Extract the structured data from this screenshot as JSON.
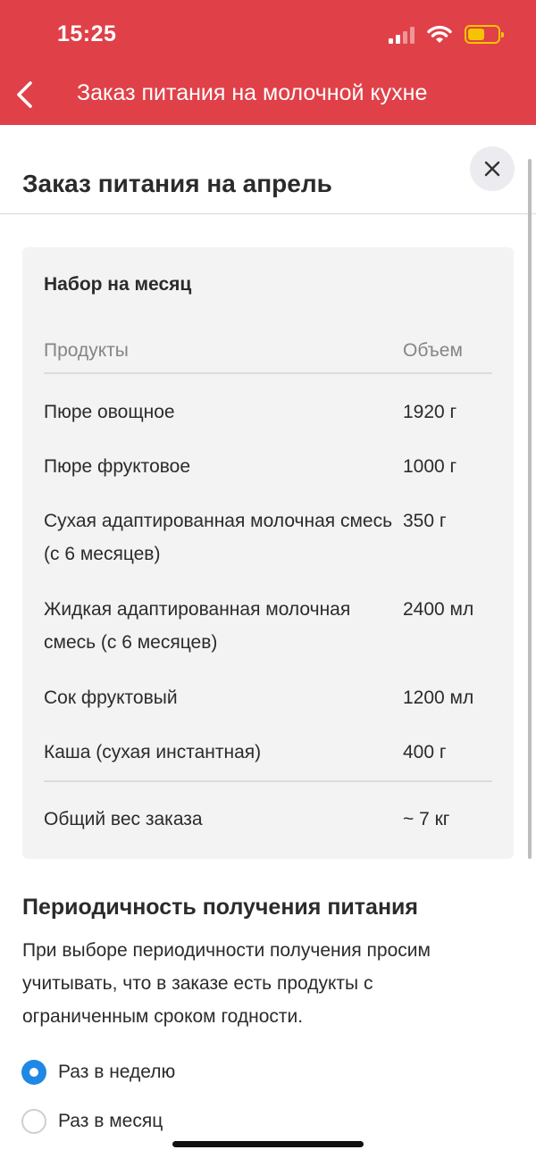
{
  "status_bar": {
    "time": "15:25"
  },
  "nav": {
    "title": "Заказ питания на молочной кухне",
    "back_icon": "chevron-left-icon"
  },
  "sheet": {
    "title": "Заказ питания на апрель",
    "close_icon": "close-icon"
  },
  "colors": {
    "header_bg": "#e04048",
    "radio_selected": "#1f88e5",
    "battery": "#f5c400"
  },
  "set_card": {
    "title": "Набор на месяц",
    "columns": {
      "product": "Продукты",
      "volume": "Объем"
    },
    "rows": [
      {
        "name": "Пюре овощное",
        "volume": "1920 г"
      },
      {
        "name": "Пюре фруктовое",
        "volume": "1000 г"
      },
      {
        "name": "Сухая адаптированная молочная смесь (с 6 месяцев)",
        "volume": "350 г"
      },
      {
        "name": "Жидкая адаптированная молочная смесь (с 6 месяцев)",
        "volume": "2400 мл"
      },
      {
        "name": "Сок фруктовый",
        "volume": "1200 мл"
      },
      {
        "name": "Каша (сухая инстантная)",
        "volume": "400 г"
      }
    ],
    "total": {
      "label": "Общий вес заказа",
      "value": "~ 7 кг"
    }
  },
  "periodicity": {
    "title": "Периодичность получения питания",
    "description": "При выборе периодичности получения просим учитывать, что в заказе есть продукты с ограниченным сроком годности.",
    "options": [
      {
        "label": "Раз в неделю",
        "selected": true
      },
      {
        "label": "Раз в месяц",
        "selected": false
      }
    ]
  }
}
